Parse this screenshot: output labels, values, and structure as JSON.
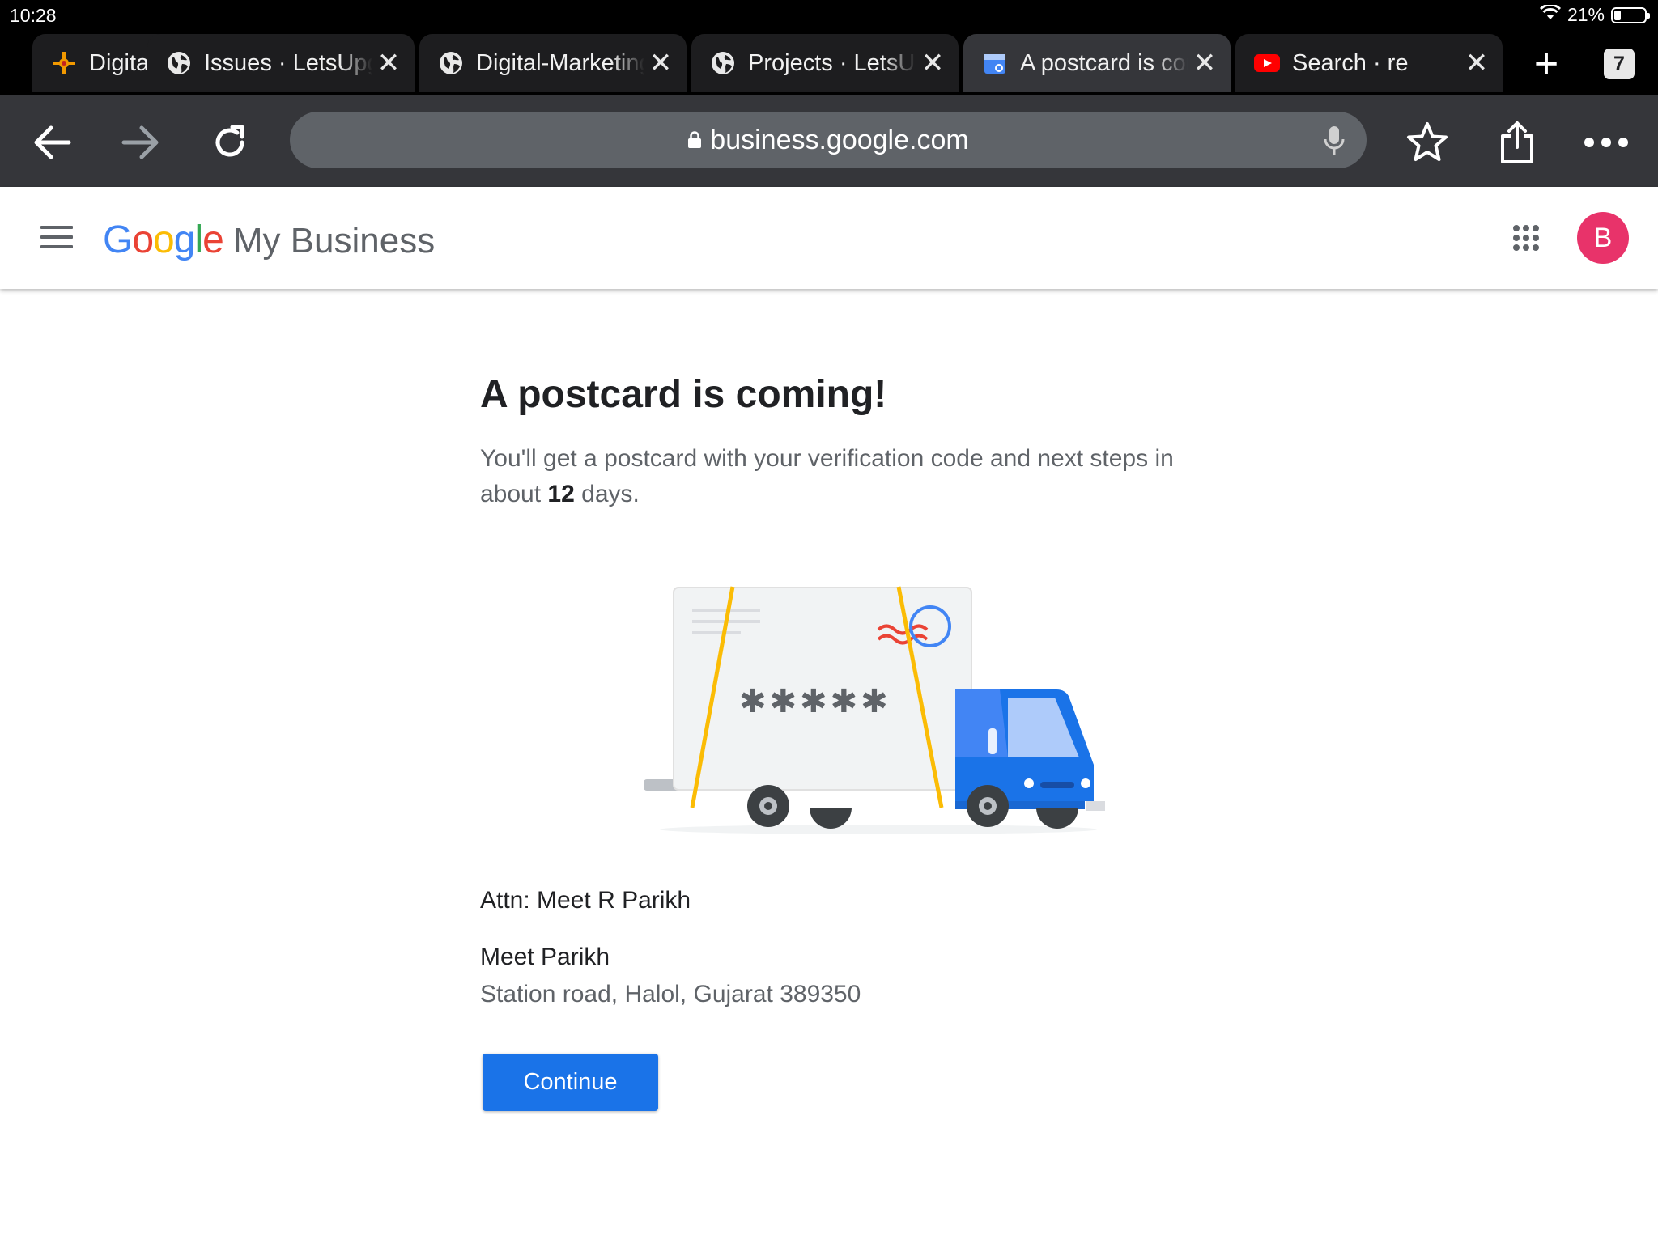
{
  "status_bar": {
    "time": "10:28",
    "battery_percent": "21%",
    "battery_level": 0.21
  },
  "tabs": [
    {
      "title": "Digital Marketing",
      "favicon": "star-burst-icon",
      "active": false
    },
    {
      "title": "Issues · LetsUpgrade",
      "favicon": "globe-icon",
      "active": false
    },
    {
      "title": "Digital-Marketing",
      "favicon": "globe-icon",
      "active": false
    },
    {
      "title": "Projects · LetsUpgrade",
      "favicon": "globe-icon",
      "active": false
    },
    {
      "title": "A postcard is coming!",
      "favicon": "google-my-business-icon",
      "active": true
    },
    {
      "title": "Search · re",
      "favicon": "youtube-icon",
      "active": false
    }
  ],
  "tab_controls": {
    "close_glyph": "✕",
    "new_tab_glyph": "+",
    "tab_count": "7"
  },
  "toolbar": {
    "url": "business.google.com"
  },
  "app": {
    "logo_letters": [
      "G",
      "o",
      "o",
      "g",
      "l",
      "e"
    ],
    "logo_colors": [
      "#4285F4",
      "#EA4335",
      "#FBBC05",
      "#4285F4",
      "#34A853",
      "#EA4335"
    ],
    "product": "My Business",
    "avatar_initial": "B",
    "avatar_color": "#e8336a"
  },
  "main": {
    "headline": "A postcard is coming!",
    "desc_before": "You'll get a postcard with your verification code and next steps in about ",
    "days": "12",
    "desc_after": " days.",
    "illustration_code": "✱✱✱✱✱",
    "attn": "Attn: Meet R Parikh",
    "address_name": "Meet Parikh",
    "address_line": "Station road, Halol, Gujarat 389350",
    "continue_label": "Continue"
  }
}
